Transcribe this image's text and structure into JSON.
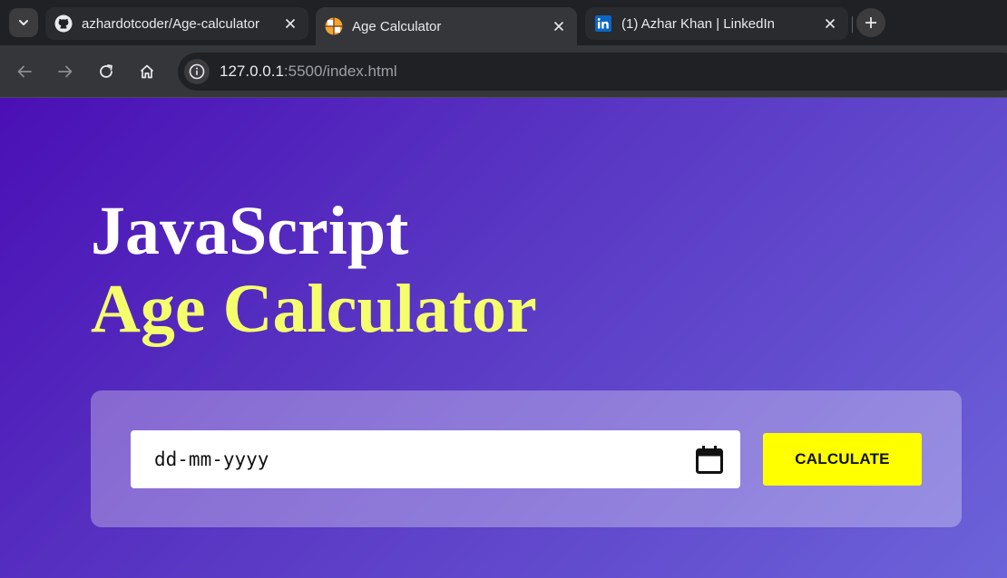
{
  "browser": {
    "tabs": [
      {
        "title": "azhardotcoder/Age-calculator",
        "favicon": "github-icon",
        "active": false
      },
      {
        "title": "Age Calculator",
        "favicon": "age-calculator-favicon",
        "active": true
      },
      {
        "title": "(1) Azhar Khan | LinkedIn",
        "favicon": "linkedin-icon",
        "active": false
      }
    ],
    "address": {
      "host": "127.0.0.1",
      "rest": ":5500/index.html"
    }
  },
  "page": {
    "heading_line1": "JavaScript",
    "heading_line2": "Age Calculator",
    "date_placeholder": "dd-mm-yyyy",
    "calculate_label": "CALCULATE"
  },
  "colors": {
    "heading_accent": "#f5ff6b",
    "button": "#ffff00",
    "gradient_start": "#4a0fb5",
    "gradient_end": "#6c63d9"
  }
}
